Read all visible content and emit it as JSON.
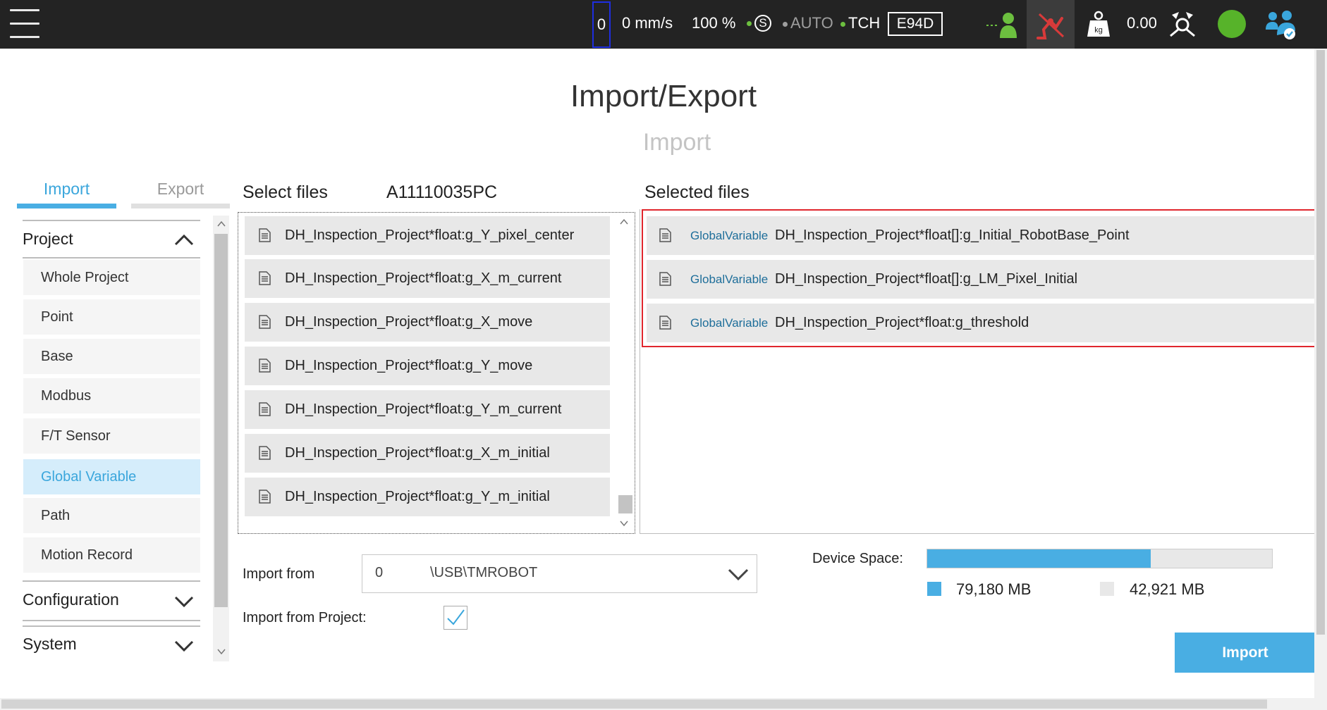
{
  "topbar": {
    "speed_value": "0",
    "speed_text": "0 mm/s",
    "percent": "100 %",
    "s_label": "S",
    "mode": "AUTO",
    "tch": "TCH",
    "code": "E94D",
    "payload": "0.00",
    "kg_label": "kg",
    "colors": {
      "green": "#6cbf3f",
      "red": "#d83a3a",
      "status": "#57b32a"
    }
  },
  "page": {
    "title": "Import/Export",
    "subtitle": "Import"
  },
  "tabs": {
    "import": "Import",
    "export": "Export"
  },
  "sidebar": {
    "project": "Project",
    "items": [
      {
        "label": "Whole Project"
      },
      {
        "label": "Point"
      },
      {
        "label": "Base"
      },
      {
        "label": "Modbus"
      },
      {
        "label": "F/T Sensor"
      },
      {
        "label": "Global Variable"
      },
      {
        "label": "Path"
      },
      {
        "label": "Motion Record"
      }
    ],
    "configuration": "Configuration",
    "system": "System"
  },
  "select_files": {
    "label": "Select files",
    "device_id": "A11110035PC",
    "files": [
      "DH_Inspection_Project*float:g_Y_pixel_center",
      "DH_Inspection_Project*float:g_X_m_current",
      "DH_Inspection_Project*float:g_X_move",
      "DH_Inspection_Project*float:g_Y_move",
      "DH_Inspection_Project*float:g_Y_m_current",
      "DH_Inspection_Project*float:g_X_m_initial",
      "DH_Inspection_Project*float:g_Y_m_initial"
    ]
  },
  "selected_files": {
    "label": "Selected files",
    "items": [
      {
        "type": "GlobalVariable",
        "name": "DH_Inspection_Project*float[]:g_Initial_RobotBase_Point"
      },
      {
        "type": "GlobalVariable",
        "name": "DH_Inspection_Project*float[]:g_LM_Pixel_Initial"
      },
      {
        "type": "GlobalVariable",
        "name": "DH_Inspection_Project*float:g_threshold"
      }
    ]
  },
  "import_from": {
    "label": "Import from",
    "drive": "0",
    "path": "\\USB\\TMROBOT",
    "project_label": "Import from Project:",
    "project_checked": true
  },
  "device_space": {
    "label": "Device Space:",
    "used": "79,180 MB",
    "free": "42,921 MB",
    "used_fraction": 0.648,
    "used_color": "#49aee3",
    "free_color": "#e8e8e8"
  },
  "import_button": "Import"
}
